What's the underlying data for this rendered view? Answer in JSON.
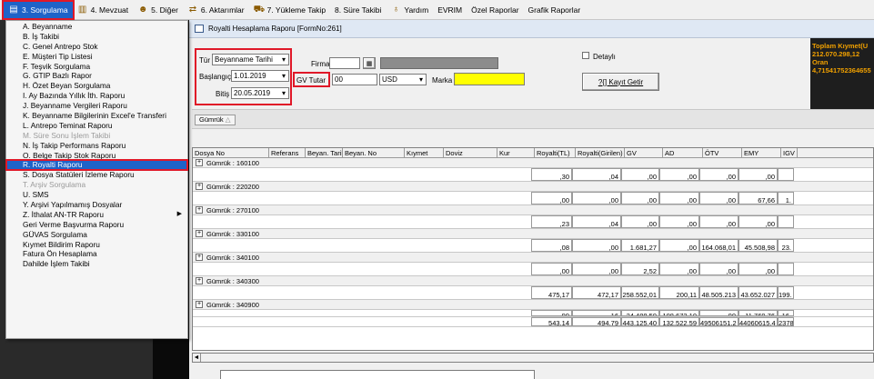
{
  "menubar": {
    "items": [
      {
        "label": "3.  Sorgulama",
        "icon": "report-icon",
        "active": true
      },
      {
        "label": "4.  Mevzuat",
        "icon": "books-icon"
      },
      {
        "label": "5.  Diğer",
        "icon": "people-icon"
      },
      {
        "label": "6.  Aktarımlar",
        "icon": "transfer-icon"
      },
      {
        "label": "7.  Yükleme Takip",
        "icon": "truck-icon"
      },
      {
        "label": "8. Süre Takibi",
        "icon": ""
      },
      {
        "label": "Yardım",
        "icon": "help-icon"
      },
      {
        "label": "EVRIM",
        "icon": ""
      },
      {
        "label": "Özel Raporlar",
        "icon": ""
      },
      {
        "label": "Grafik Raporlar",
        "icon": ""
      }
    ]
  },
  "dropdown": {
    "items": [
      {
        "label": "A. Beyanname"
      },
      {
        "label": "B. İş Takibi"
      },
      {
        "label": "C. Genel Antrepo Stok"
      },
      {
        "label": "E. Müşteri Tip Listesi"
      },
      {
        "label": "F. Teşvik Sorgulama"
      },
      {
        "label": "G. GTIP Bazlı Rapor"
      },
      {
        "label": "H. Özet Beyan Sorgulama"
      },
      {
        "label": "I. Ay Bazında Yıllık İth. Raporu"
      },
      {
        "label": "J. Beyanname Vergileri Raporu"
      },
      {
        "label": "K. Beyanname Bilgilerinin Excel'e Transferi"
      },
      {
        "label": "L. Antrepo Teminat Raporu"
      },
      {
        "label": "M. Süre Sonu İşlem Takibi",
        "disabled": true
      },
      {
        "label": "N. İş Takip Performans Raporu"
      },
      {
        "label": "O. Belge Takip Stok Raporu"
      },
      {
        "label": "R. Royalti Raporu",
        "selected": true
      },
      {
        "label": "S. Dosya Statüleri İzleme Raporu"
      },
      {
        "label": "T. Arşiv Sorgulama",
        "disabled": true
      },
      {
        "label": "U. SMS"
      },
      {
        "label": "Y. Arşivi Yapılmamış Dosyalar"
      },
      {
        "label": "Z. İthalat AN-TR Raporu",
        "submenu": true
      },
      {
        "label": "Geri Verme Başvurma Raporu"
      },
      {
        "label": "GÜVAS Sorgulama"
      },
      {
        "label": "Kıymet Bildirim Raporu"
      },
      {
        "label": "Fatura Ön Hesaplama"
      },
      {
        "label": "Dahilde İşlem Takibi"
      }
    ]
  },
  "window": {
    "title": "Royalti Hesaplama Raporu [FormNo:261]",
    "tur_label": "Tür",
    "tur_value": "Beyanname Tarihi",
    "baslangic_label": "Başlangıç",
    "baslangic_value": "1.01.2019",
    "bitis_label": "Bitiş",
    "bitis_value": "20.05.2019",
    "firma_label": "Firma",
    "gv_label": "GV Tutar",
    "gv_value": "00",
    "currency_value": "USD",
    "marka_label": "Marka",
    "detayli_label": "Detaylı",
    "kayit_button": "?{] Kayıt Getir",
    "toplam_lines": [
      "Toplam Kıymet(U",
      "212.070.298,12",
      "Oran",
      "4,71541752364655"
    ],
    "group_chip": "Gümrük",
    "group_chip_arrow": "△"
  },
  "grid": {
    "columns": [
      "Dosya No",
      "Referans",
      "Beyan. Tarihi",
      "Beyan. No",
      "Kıymet",
      "Doviz",
      "Kur",
      "Royalti(TL)",
      "Royalti(Girilen)",
      "GV",
      "AD",
      "ÖTV",
      "EMY",
      "IGV"
    ],
    "groups": [
      {
        "label": "Gümrük : 160100",
        "values": [
          ",30",
          ",04",
          ",00",
          ",00",
          ",00",
          ",00",
          ""
        ]
      },
      {
        "label": "Gümrük : 220200",
        "values": [
          ",00",
          ",00",
          ",00",
          ",00",
          ",00",
          "67,66",
          "1."
        ]
      },
      {
        "label": "Gümrük : 270100",
        "values": [
          ",23",
          ",04",
          ",00",
          ",00",
          ",00",
          ",00",
          ""
        ]
      },
      {
        "label": "Gümrük : 330100",
        "values": [
          ",08",
          ",00",
          "1.681,27",
          ",00",
          "164.068,01",
          "45.508,98",
          "23."
        ]
      },
      {
        "label": "Gümrük : 340100",
        "values": [
          ",00",
          ",00",
          "2,52",
          ",00",
          ",00",
          ",00",
          ""
        ]
      },
      {
        "label": "Gümrük : 340300",
        "values": [
          "475,17",
          "472,17",
          "258.552,01",
          "200,11",
          "48.505.213",
          "43.652.027",
          "199."
        ]
      },
      {
        "label": "Gümrük : 340900",
        "values": [
          ",99",
          "16",
          "24.488,59",
          "108.672,10",
          ",00",
          "11.769,76",
          "16."
        ]
      }
    ],
    "totals": [
      "543,14",
      "494,79",
      "443.125,40",
      "132.522,59",
      "49506151,2",
      "44060615,4",
      "2378"
    ]
  },
  "colors": {
    "accent": "#1e63c8",
    "highlight": "#e01828",
    "marka": "#ffff00",
    "toplam_text": "#f0a000"
  }
}
